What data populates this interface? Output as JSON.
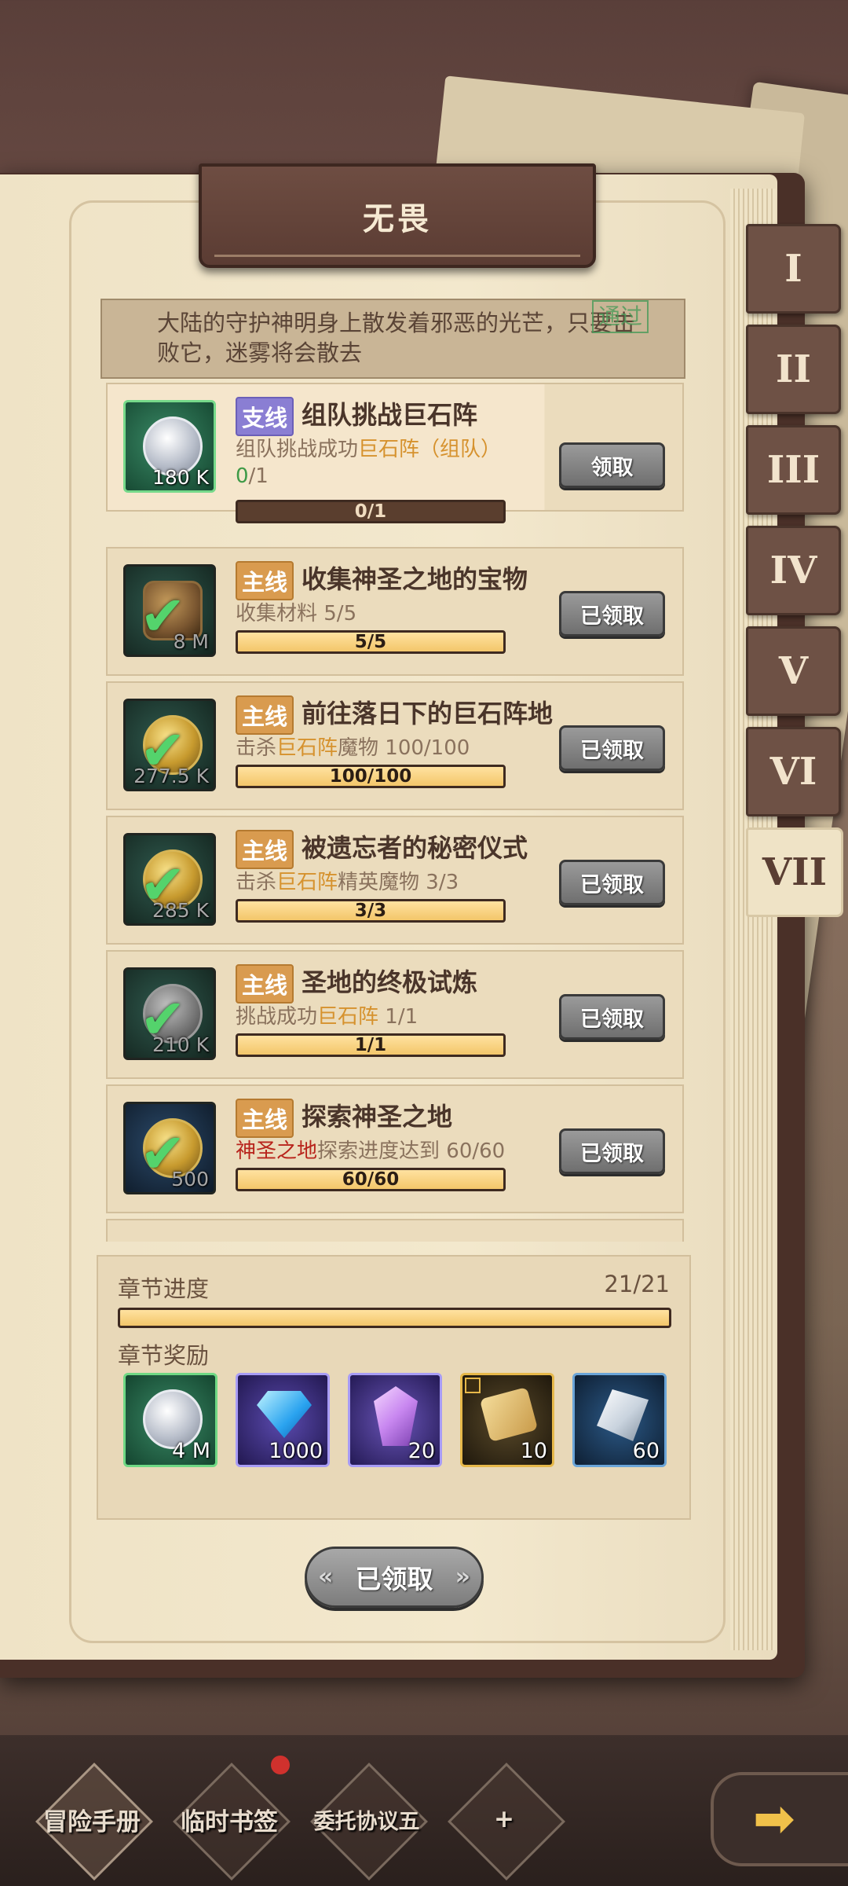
{
  "chapter_title": "无畏",
  "chapter_tabs": [
    "I",
    "II",
    "III",
    "IV",
    "V",
    "VI",
    "VII"
  ],
  "active_tab": "VII",
  "description": {
    "text": "大陆的守护神明身上散发着邪恶的光芒，只要击败它，迷雾将会散去",
    "stamp": "通过"
  },
  "tasks": [
    {
      "type_label": "支线",
      "type": "side",
      "title": "组队挑战巨石阵",
      "desc_prefix": "组队挑战成功",
      "desc_highlight": "巨石阵（组队）",
      "desc_suffix": "",
      "count_done": "0",
      "count_total": "/1",
      "progress_label": "0/1",
      "progress": 0.0,
      "reward_amount": "180 K",
      "reward_icon": "silver-coin-icon",
      "claimed": false,
      "button": "领取"
    },
    {
      "type_label": "主线",
      "type": "main",
      "title": "收集神圣之地的宝物",
      "desc_prefix": "收集材料 5/5",
      "desc_highlight": "",
      "desc_suffix": "",
      "progress_label": "5/5",
      "progress": 1.0,
      "reward_amount": "8 M",
      "reward_icon": "treasure-chest-icon",
      "claimed": true,
      "button": "已领取"
    },
    {
      "type_label": "主线",
      "type": "main",
      "title": "前往落日下的巨石阵地",
      "desc_prefix": "击杀",
      "desc_highlight": "巨石阵",
      "desc_suffix": "魔物 100/100",
      "progress_label": "100/100",
      "progress": 1.0,
      "reward_amount": "277.5 K",
      "reward_icon": "gold-coin-icon",
      "claimed": true,
      "button": "已领取"
    },
    {
      "type_label": "主线",
      "type": "main",
      "title": "被遗忘者的秘密仪式",
      "desc_prefix": "击杀",
      "desc_highlight": "巨石阵",
      "desc_suffix": "精英魔物 3/3",
      "progress_label": "3/3",
      "progress": 1.0,
      "reward_amount": "285 K",
      "reward_icon": "gold-coin-icon",
      "claimed": true,
      "button": "已领取"
    },
    {
      "type_label": "主线",
      "type": "main",
      "title": "圣地的终极试炼",
      "desc_prefix": "挑战成功",
      "desc_highlight": "巨石阵",
      "desc_suffix": " 1/1",
      "progress_label": "1/1",
      "progress": 1.0,
      "reward_amount": "210 K",
      "reward_icon": "silver-coin-icon",
      "claimed": true,
      "button": "已领取"
    },
    {
      "type_label": "主线",
      "type": "main",
      "title": "探索神圣之地",
      "desc_red": "神圣之地",
      "desc_suffix": "探索进度达到 60/60",
      "progress_label": "60/60",
      "progress": 1.0,
      "reward_amount": "500",
      "reward_icon": "gold-coin-icon",
      "claimed": true,
      "button": "已领取"
    }
  ],
  "chapter_progress": {
    "label": "章节进度",
    "value": "21/21",
    "progress": 1.0
  },
  "chapter_rewards": {
    "label": "章节奖励",
    "items": [
      {
        "icon": "silver-coin-icon",
        "amount": "4 M"
      },
      {
        "icon": "diamond-gem-icon",
        "amount": "1000"
      },
      {
        "icon": "purple-crystal-icon",
        "amount": "20"
      },
      {
        "icon": "scroll-icon",
        "amount": "10"
      },
      {
        "icon": "silver-shard-icon",
        "amount": "60"
      }
    ]
  },
  "claim_all_button": "已领取",
  "bottom_nav": [
    {
      "label": "冒险手册",
      "active": true
    },
    {
      "label": "临时书签",
      "badge": true
    },
    {
      "label": "委托协议五"
    },
    {
      "label": "+"
    }
  ],
  "colors": {
    "accent_gold": "#f3c66a",
    "highlight": "#d6922e",
    "main_tag": "#d99b4f",
    "side_tag": "#8a7ed3"
  }
}
